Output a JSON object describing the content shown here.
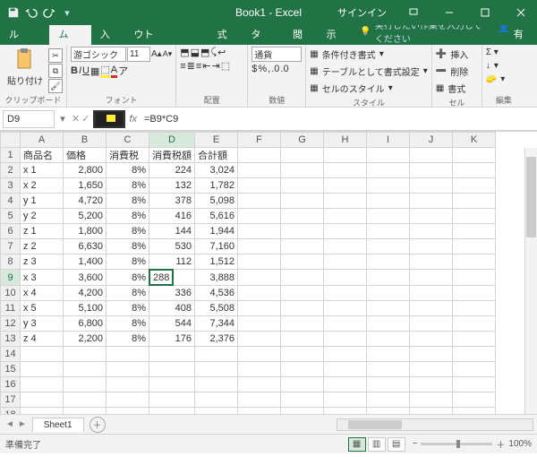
{
  "title": "Book1 - Excel",
  "signin": "サインイン",
  "tabs": {
    "file": "ファイル",
    "home": "ホーム",
    "insert": "挿入",
    "layout": "ページ レイアウト",
    "formulas": "数式",
    "data": "データ",
    "review": "校閲",
    "view": "表示"
  },
  "tellme": "実行したい作業を入力してください",
  "share": "共有",
  "ribbon": {
    "clipboard": {
      "paste": "貼り付け",
      "label": "クリップボード"
    },
    "font": {
      "name": "游ゴシック",
      "size": "11",
      "label": "フォント"
    },
    "align": {
      "label": "配置"
    },
    "number": {
      "format": "通貨",
      "label": "数値"
    },
    "styles": {
      "cond": "条件付き書式",
      "table": "テーブルとして書式設定",
      "cell": "セルのスタイル",
      "label": "スタイル"
    },
    "cells": {
      "insert": "挿入",
      "delete": "削除",
      "format": "書式",
      "label": "セル"
    },
    "editing": {
      "label": "編集"
    }
  },
  "namebox": "D9",
  "formula": "=B9*C9",
  "columns": [
    "A",
    "B",
    "C",
    "D",
    "E",
    "F",
    "G",
    "H",
    "I",
    "J",
    "K"
  ],
  "headers": {
    "A": "商品名",
    "B": "価格",
    "C": "消費税",
    "D": "消費税額",
    "E": "合計額"
  },
  "rows": [
    {
      "n": "x 1",
      "p": "2,800",
      "t": "8%",
      "a": "224",
      "s": "3,024"
    },
    {
      "n": "x 2",
      "p": "1,650",
      "t": "8%",
      "a": "132",
      "s": "1,782"
    },
    {
      "n": "y 1",
      "p": "4,720",
      "t": "8%",
      "a": "378",
      "s": "5,098"
    },
    {
      "n": "y 2",
      "p": "5,200",
      "t": "8%",
      "a": "416",
      "s": "5,616"
    },
    {
      "n": "z 1",
      "p": "1,800",
      "t": "8%",
      "a": "144",
      "s": "1,944"
    },
    {
      "n": "z 2",
      "p": "6,630",
      "t": "8%",
      "a": "530",
      "s": "7,160"
    },
    {
      "n": "z 3",
      "p": "1,400",
      "t": "8%",
      "a": "112",
      "s": "1,512"
    },
    {
      "n": "x 3",
      "p": "3,600",
      "t": "8%",
      "a": "288",
      "s": "3,888"
    },
    {
      "n": "x 4",
      "p": "4,200",
      "t": "8%",
      "a": "336",
      "s": "4,536"
    },
    {
      "n": "x 5",
      "p": "5,100",
      "t": "8%",
      "a": "408",
      "s": "5,508"
    },
    {
      "n": "y 3",
      "p": "6,800",
      "t": "8%",
      "a": "544",
      "s": "7,344"
    },
    {
      "n": "z 4",
      "p": "2,200",
      "t": "8%",
      "a": "176",
      "s": "2,376"
    }
  ],
  "selected": {
    "row": 9,
    "col": "D"
  },
  "sheet": "Sheet1",
  "status": "準備完了",
  "zoom": "100%",
  "chart_data": {
    "type": "table",
    "columns": [
      "商品名",
      "価格",
      "消費税",
      "消費税額",
      "合計額"
    ],
    "data": [
      [
        "x 1",
        2800,
        0.08,
        224,
        3024
      ],
      [
        "x 2",
        1650,
        0.08,
        132,
        1782
      ],
      [
        "y 1",
        4720,
        0.08,
        378,
        5098
      ],
      [
        "y 2",
        5200,
        0.08,
        416,
        5616
      ],
      [
        "z 1",
        1800,
        0.08,
        144,
        1944
      ],
      [
        "z 2",
        6630,
        0.08,
        530,
        7160
      ],
      [
        "z 3",
        1400,
        0.08,
        112,
        1512
      ],
      [
        "x 3",
        3600,
        0.08,
        288,
        3888
      ],
      [
        "x 4",
        4200,
        0.08,
        336,
        4536
      ],
      [
        "x 5",
        5100,
        0.08,
        408,
        5508
      ],
      [
        "y 3",
        6800,
        0.08,
        544,
        7344
      ],
      [
        "z 4",
        2200,
        0.08,
        176,
        2376
      ]
    ]
  }
}
